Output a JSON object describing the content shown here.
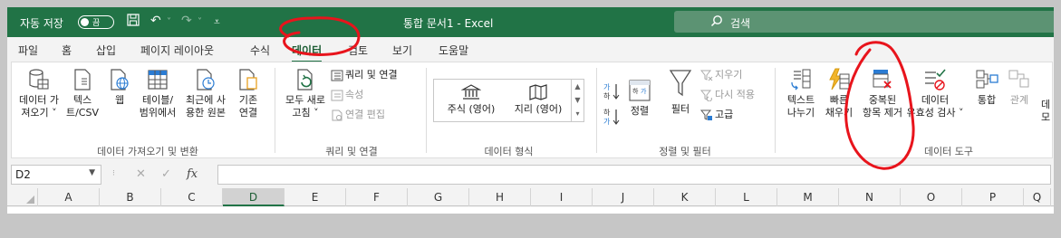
{
  "titlebar": {
    "autosave_label": "자동 저장",
    "autosave_state": "끔",
    "document_title": "통합 문서1  -  Excel",
    "search_placeholder": "검색"
  },
  "tabs": [
    "파일",
    "홈",
    "삽입",
    "페이지 레이아웃",
    "수식",
    "데이터",
    "검토",
    "보기",
    "도움말"
  ],
  "active_tab": "데이터",
  "ribbon": {
    "get_transform": {
      "group_label": "데이터 가져오기 및 변환",
      "buttons": [
        {
          "line1": "데이터 가",
          "line2": "져오기 ˅"
        },
        {
          "line1": "텍스",
          "line2": "트/CSV"
        },
        {
          "line1": "웹",
          "line2": ""
        },
        {
          "line1": "테이블/",
          "line2": "범위에서"
        },
        {
          "line1": "최근에 사",
          "line2": "용한 원본"
        },
        {
          "line1": "기존",
          "line2": "연결"
        }
      ]
    },
    "queries": {
      "group_label": "쿼리 및 연결",
      "refresh_line1": "모두 새로",
      "refresh_line2": "고침 ˅",
      "small": [
        "쿼리 및 연결",
        "속성",
        "연결 편집"
      ]
    },
    "data_types": {
      "group_label": "데이터 형식",
      "items": [
        "주식 (영어)",
        "지리 (영어)"
      ]
    },
    "sort_filter": {
      "group_label": "정렬 및 필터",
      "sort_label": "정렬",
      "filter_label": "필터",
      "small": [
        "지우기",
        "다시 적용",
        "고급"
      ]
    },
    "data_tools": {
      "group_label": "데이터 도구",
      "buttons": [
        {
          "line1": "텍스트",
          "line2": "나누기"
        },
        {
          "line1": "빠른",
          "line2": "채우기"
        },
        {
          "line1": "중복된",
          "line2": "항목 제거"
        },
        {
          "line1": "데이터",
          "line2": "유효성 검사 ˅"
        },
        {
          "line1": "통합",
          "line2": ""
        },
        {
          "line1": "관계",
          "line2": ""
        }
      ],
      "cut_off_label_1": "데",
      "cut_off_label_2": "모"
    }
  },
  "formula_bar": {
    "name_box": "D2",
    "fx_label": "fx",
    "formula": ""
  },
  "columns": [
    "A",
    "B",
    "C",
    "D",
    "E",
    "F",
    "G",
    "H",
    "I",
    "J",
    "K",
    "L",
    "M",
    "N",
    "O",
    "P",
    "Q"
  ],
  "selected_column": "D",
  "colors": {
    "excel_green": "#217346",
    "annotation_red": "#e8141c"
  }
}
